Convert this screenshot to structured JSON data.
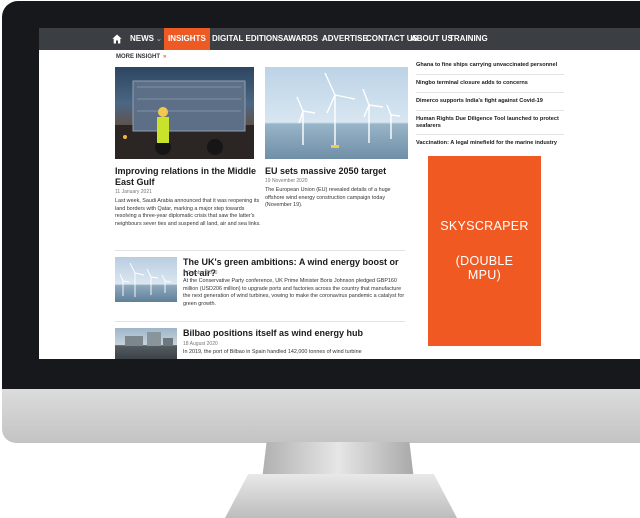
{
  "nav": {
    "items": [
      "NEWS",
      "INSIGHTS",
      "DIGITAL EDITIONS",
      "AWARDS",
      "ADVERTISE",
      "CONTACT US",
      "ABOUT US",
      "TRAINING"
    ],
    "active": "INSIGHTS",
    "accent_color": "#ee5a24",
    "bar_color": "#3b3e42"
  },
  "section_label": "MORE INSIGHT",
  "articles": [
    {
      "title": "Improving relations in the Middle East Gulf",
      "date": "11 January 2021",
      "summary": "Last week, Saudi Arabia announced that it was reopening its land borders with Qatar, marking a major step towards resolving a three-year diplomatic crisis that saw the latter's neighbours sever ties and suspend all land, air and sea links."
    },
    {
      "title": "EU sets massive 2050 target",
      "date": "19 November 2020",
      "summary": "The European Union (EU) revealed details of a huge offshore wind energy construction campaign today (November 19)."
    },
    {
      "title": "The UK's green ambitions: A wind energy boost or hot air?",
      "date": "7 October 2020",
      "summary": "At the Conservative Party conference, UK Prime Minister Boris Johnson pledged GBP160 million (USD206 million) to upgrade ports and factories across the country that manufacture the next generation of wind turbines, vowing to make the coronavirus pandemic a catalyst for green growth."
    },
    {
      "title": "Bilbao positions itself as wind energy hub",
      "date": "18 August 2020",
      "summary": "In 2019, the port of Bilbao in Spain handled 142,000 tonnes of wind turbine"
    }
  ],
  "sidebar_headlines": [
    "Ghana to fine ships carrying unvaccinated personnel",
    "Ningbo terminal closure adds to concerns",
    "Dimerco supports India's fight against Covid-19",
    "Human Rights Due Diligence Tool launched to protect seafarers",
    "Vaccination: A legal minefield for the marine industry"
  ],
  "ad": {
    "line1": "SKYSCRAPER",
    "line2": "(DOUBLE",
    "line3": "MPU)",
    "color": "#f05a22"
  }
}
